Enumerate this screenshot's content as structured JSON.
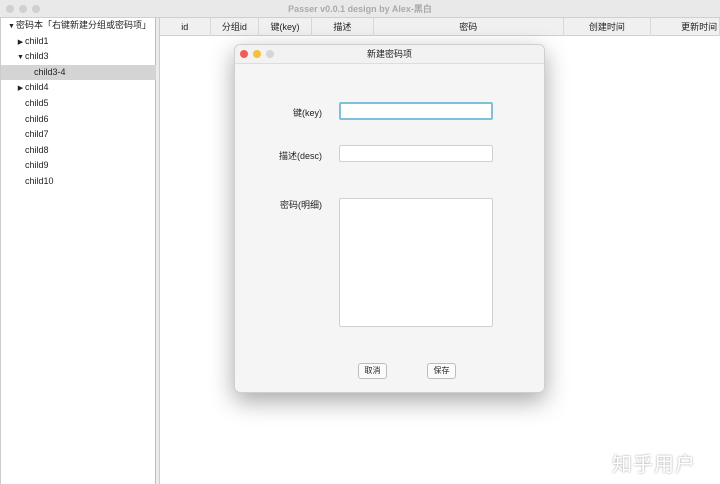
{
  "window": {
    "title": "Passer v0.0.1 design by Alex-黑白"
  },
  "sidebar": {
    "root": "密码本「右键新建分组或密码项」",
    "items": [
      {
        "label": "child1",
        "arrow": "▶"
      },
      {
        "label": "child3",
        "arrow": "▼"
      },
      {
        "label": "child3-4",
        "arrow": ""
      },
      {
        "label": "child4",
        "arrow": "▶"
      },
      {
        "label": "child5",
        "arrow": ""
      },
      {
        "label": "child6",
        "arrow": ""
      },
      {
        "label": "child7",
        "arrow": ""
      },
      {
        "label": "child8",
        "arrow": ""
      },
      {
        "label": "child9",
        "arrow": ""
      },
      {
        "label": "child10",
        "arrow": ""
      }
    ]
  },
  "table": {
    "columns": [
      "id",
      "分组id",
      "键(key)",
      "描述",
      "密码",
      "创建时间",
      "更新时间"
    ]
  },
  "dialog": {
    "title": "新建密码项",
    "key_label": "键(key)",
    "key_value": "",
    "desc_label": "描述(desc)",
    "desc_value": "",
    "password_label": "密码(明细)",
    "password_value": "",
    "cancel": "取消",
    "save": "保存"
  },
  "watermark": "知乎用户",
  "colors": {
    "close": "#f25a55",
    "minimize": "#f5be3b",
    "zoom": "#cfcfcf",
    "focus": "#7fbfd9"
  }
}
